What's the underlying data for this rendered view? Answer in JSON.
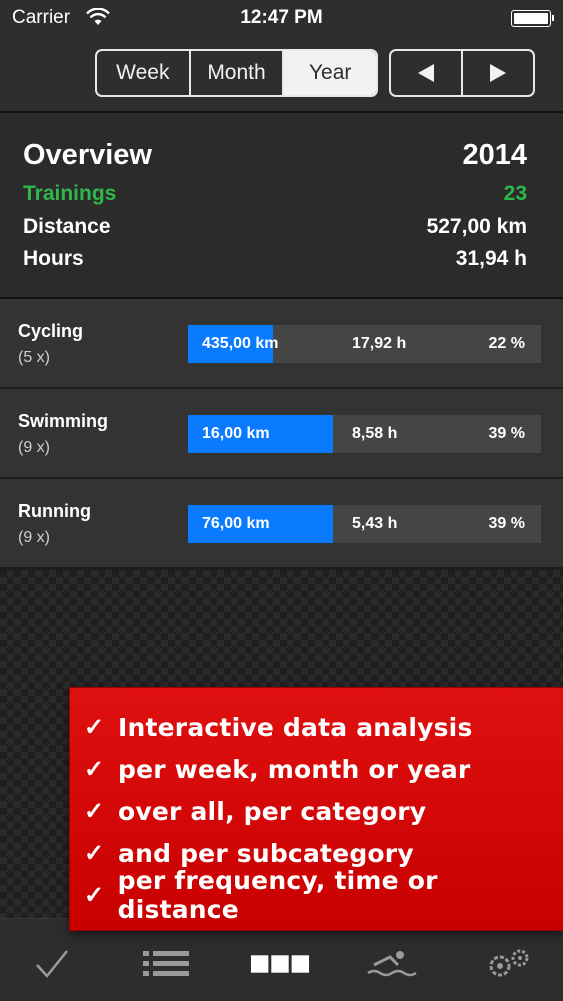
{
  "status_bar": {
    "carrier": "Carrier",
    "time": "12:47 PM"
  },
  "period_selector": {
    "options": [
      "Week",
      "Month",
      "Year"
    ],
    "selected": "Year"
  },
  "overview": {
    "title": "Overview",
    "year": "2014",
    "trainings_label": "Trainings",
    "trainings_value": "23",
    "distance_label": "Distance",
    "distance_value": "527,00 km",
    "hours_label": "Hours",
    "hours_value": "31,94 h"
  },
  "categories": [
    {
      "name": "Cycling",
      "count": "(5 x)",
      "distance": "435,00 km",
      "hours": "17,92 h",
      "percent": "22 %",
      "bar_fill": 0.24
    },
    {
      "name": "Swimming",
      "count": "(9 x)",
      "distance": "16,00 km",
      "hours": "8,58 h",
      "percent": "39 %",
      "bar_fill": 0.41
    },
    {
      "name": "Running",
      "count": "(9 x)",
      "distance": "76,00 km",
      "hours": "5,43 h",
      "percent": "39 %",
      "bar_fill": 0.41
    }
  ],
  "promo": {
    "items": [
      "Interactive data analysis",
      "per week, month or year",
      "over all, per category",
      "and per subcategory",
      "per frequency, time or distance"
    ],
    "check_symbol": "✓"
  },
  "tabbar": {
    "icons": [
      "checkmark-icon",
      "list-icon",
      "grid-icon",
      "swimmer-icon",
      "gears-icon"
    ],
    "active": "grid-icon"
  },
  "colors": {
    "accent_blue": "#0a7bff",
    "green": "#2fb84a",
    "promo_red": "#d80000"
  }
}
